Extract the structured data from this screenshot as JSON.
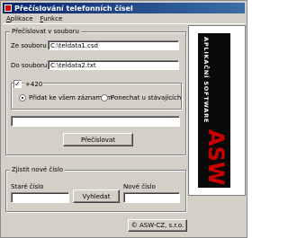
{
  "window": {
    "title": "Přečíslování telefonních čísel"
  },
  "menu": [
    {
      "mnemonic": "A",
      "rest": "plikace"
    },
    {
      "mnemonic": "F",
      "rest": "unkce"
    }
  ],
  "renumber_group": {
    "legend": "Přečíslovat v souboru",
    "source_label": "Ze souboru",
    "source_value": "C:\\teldata1.csd",
    "dest_label": "Do souboru",
    "dest_value": "C:\\teldata2.txt"
  },
  "prefix_group": {
    "checkbox_mark": "✓",
    "checkbox_label": "+420",
    "radio_add_label": "Přidat ke všem záznamům",
    "radio_keep_label": "Ponechat u stávajících"
  },
  "progress": {
    "value": ""
  },
  "renumber_button": "Přečíslovat",
  "find_group": {
    "legend": "Zjistit nové číslo",
    "old_label": "Staré číslo",
    "old_value": "",
    "find_button": "Vyhledat",
    "new_label": "Nové číslo",
    "new_value": ""
  },
  "logo": {
    "brand": "ASW",
    "tagline": "APLIKAČNÍ SOFTWARE",
    "brand_color": "#cc0000"
  },
  "copyright_button": "© ASW-CZ, s.r.o."
}
